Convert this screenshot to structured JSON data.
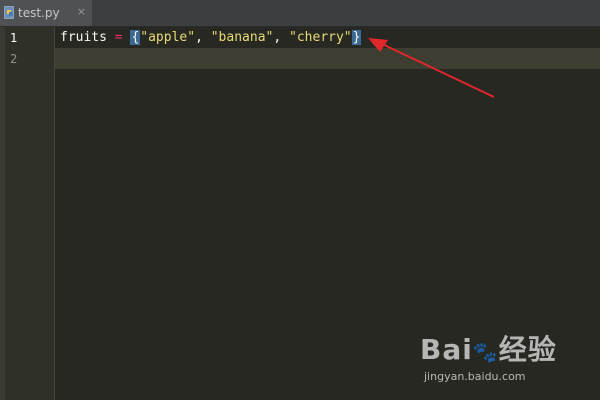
{
  "tab": {
    "filename": "test.py",
    "close_glyph": "×",
    "icon": "python-file-icon"
  },
  "gutter": {
    "line_numbers": [
      "1",
      "2"
    ]
  },
  "code": {
    "lines": [
      {
        "tokens": [
          {
            "type": "identifier",
            "text": "fruits"
          },
          {
            "type": "space",
            "text": " "
          },
          {
            "type": "operator",
            "text": "="
          },
          {
            "type": "space",
            "text": " "
          },
          {
            "type": "brace",
            "text": "{"
          },
          {
            "type": "string",
            "text": "\"apple\""
          },
          {
            "type": "punc",
            "text": ", "
          },
          {
            "type": "string",
            "text": "\"banana\""
          },
          {
            "type": "punc",
            "text": ", "
          },
          {
            "type": "string",
            "text": "\"cherry\""
          },
          {
            "type": "brace",
            "text": "}"
          }
        ]
      },
      {
        "tokens": []
      }
    ],
    "current_line": "2"
  },
  "annotation": {
    "arrow_color": "#e0272b"
  },
  "watermark": {
    "brand": "Bai",
    "brand2": "经验",
    "url": "jingyan.baidu.com"
  },
  "colors": {
    "background": "#272822",
    "string": "#e6db74",
    "operator": "#f92672",
    "brace_highlight": "#3a6a93"
  }
}
